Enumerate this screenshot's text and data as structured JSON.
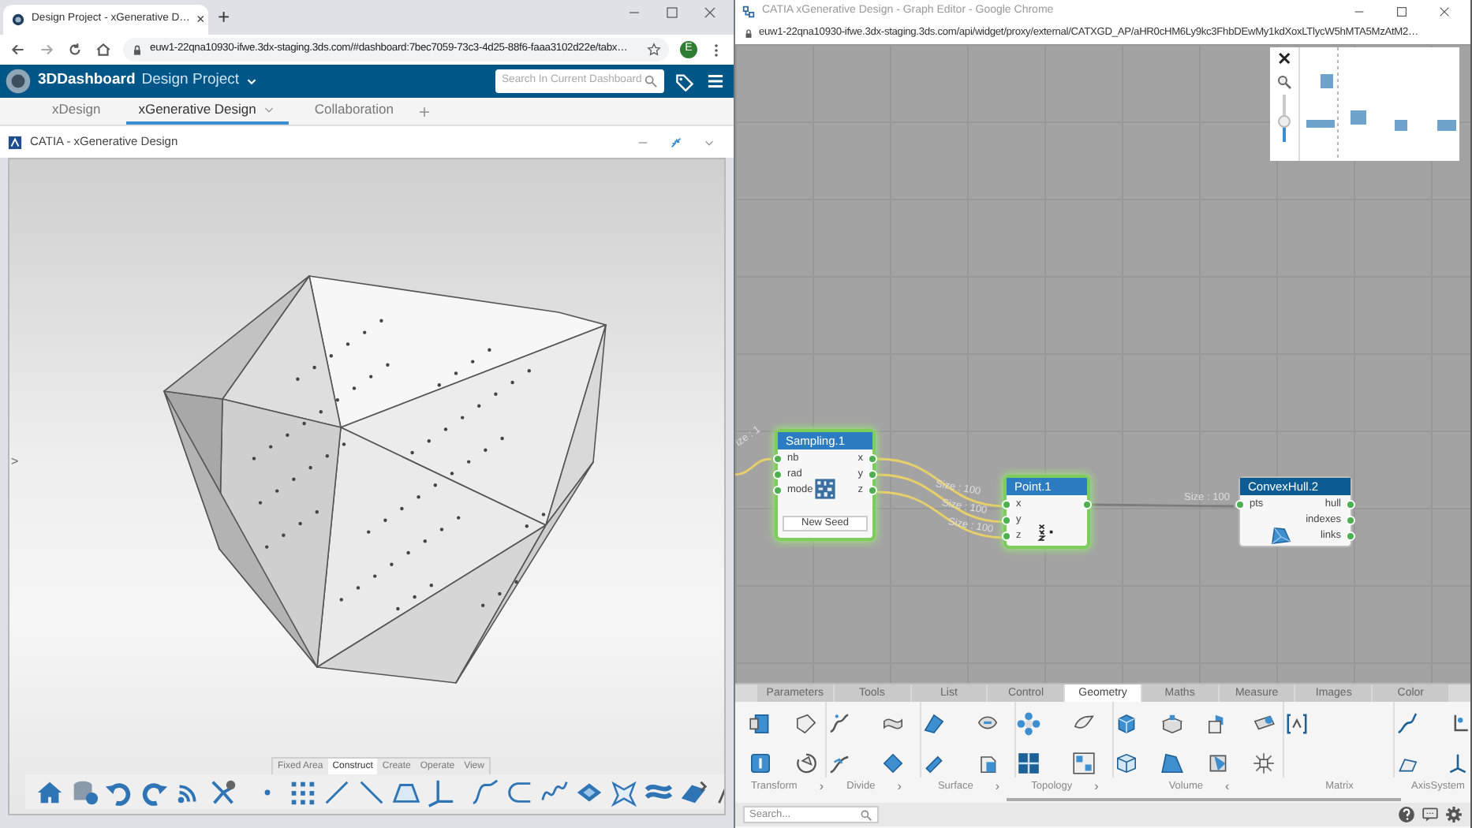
{
  "left_window": {
    "tab": {
      "title": "Design Project - xGenerative D…",
      "close": "×",
      "new_tab": "+"
    },
    "url": "euw1-22qna10930-ifwe.3dx-staging.3ds.com/#dashboard:7bec7059-73c3-4d25-88f6-faaa3102d22e/tabx…",
    "avatar": "E",
    "dashboard": {
      "brand": "3DDashboard",
      "project": "Design Project",
      "search_placeholder": "Search In Current Dashboard"
    },
    "tabs": [
      {
        "label": "xDesign",
        "selected": false
      },
      {
        "label": "xGenerative Design",
        "selected": true
      },
      {
        "label": "Collaboration",
        "selected": false
      }
    ],
    "add_tab": "+",
    "widget": {
      "title": "CATIA - xGenerative Design"
    },
    "side_toggle": ">",
    "toolbar_tabs": [
      {
        "label": "Fixed Area",
        "selected": false
      },
      {
        "label": "Construct",
        "selected": true
      },
      {
        "label": "Create",
        "selected": false
      },
      {
        "label": "Operate",
        "selected": false
      },
      {
        "label": "View",
        "selected": false
      }
    ]
  },
  "right_window": {
    "title": "CATIA xGenerative Design - Graph Editor - Google Chrome",
    "url": "euw1-22qna10930-ifwe.3dx-staging.3ds.com/api/widget/proxy/external/CATXGD_AP/aHR0cHM6Ly9kc3FhbDEwMy1kdXoxLTlycW5hMTA5MzAtM2…",
    "minimap": {
      "close": "✕",
      "zoom_slider": {
        "level": 0.45
      }
    },
    "nodes": [
      {
        "title": "Sampling.1",
        "selected": true,
        "inputs": [
          "nb",
          "rad",
          "mode"
        ],
        "outputs": [
          "x",
          "y",
          "z"
        ],
        "button": "New Seed"
      },
      {
        "title": "Point.1",
        "selected": true,
        "inputs": [
          "x",
          "y",
          "z"
        ],
        "output_port": true
      },
      {
        "title": "ConvexHull.2",
        "selected": false,
        "inputs": [
          "pts"
        ],
        "outputs": [
          "hull",
          "indexes",
          "links"
        ]
      }
    ],
    "edges": [
      {
        "label": "ize : 1"
      },
      {
        "label": "Size : 100"
      },
      {
        "label": "Size : 100"
      },
      {
        "label": "Size : 100"
      },
      {
        "label": "Size : 100"
      }
    ],
    "library": {
      "tabs": [
        {
          "label": "Parameters",
          "selected": false
        },
        {
          "label": "Tools",
          "selected": false
        },
        {
          "label": "List",
          "selected": false
        },
        {
          "label": "Control",
          "selected": false
        },
        {
          "label": "Geometry",
          "selected": true
        },
        {
          "label": "Maths",
          "selected": false
        },
        {
          "label": "Measure",
          "selected": false
        },
        {
          "label": "Images",
          "selected": false
        },
        {
          "label": "Color",
          "selected": false
        }
      ],
      "groups": [
        {
          "label": "Transform",
          "arrow": "›"
        },
        {
          "label": "Divide",
          "arrow": "›"
        },
        {
          "label": "Surface",
          "arrow": "›"
        },
        {
          "label": "Topology",
          "arrow": "›"
        },
        {
          "label": "Volume",
          "arrow": "‹"
        },
        {
          "label": "Matrix"
        },
        {
          "label": "AxisSystem"
        }
      ],
      "search_placeholder": "Search..."
    }
  }
}
